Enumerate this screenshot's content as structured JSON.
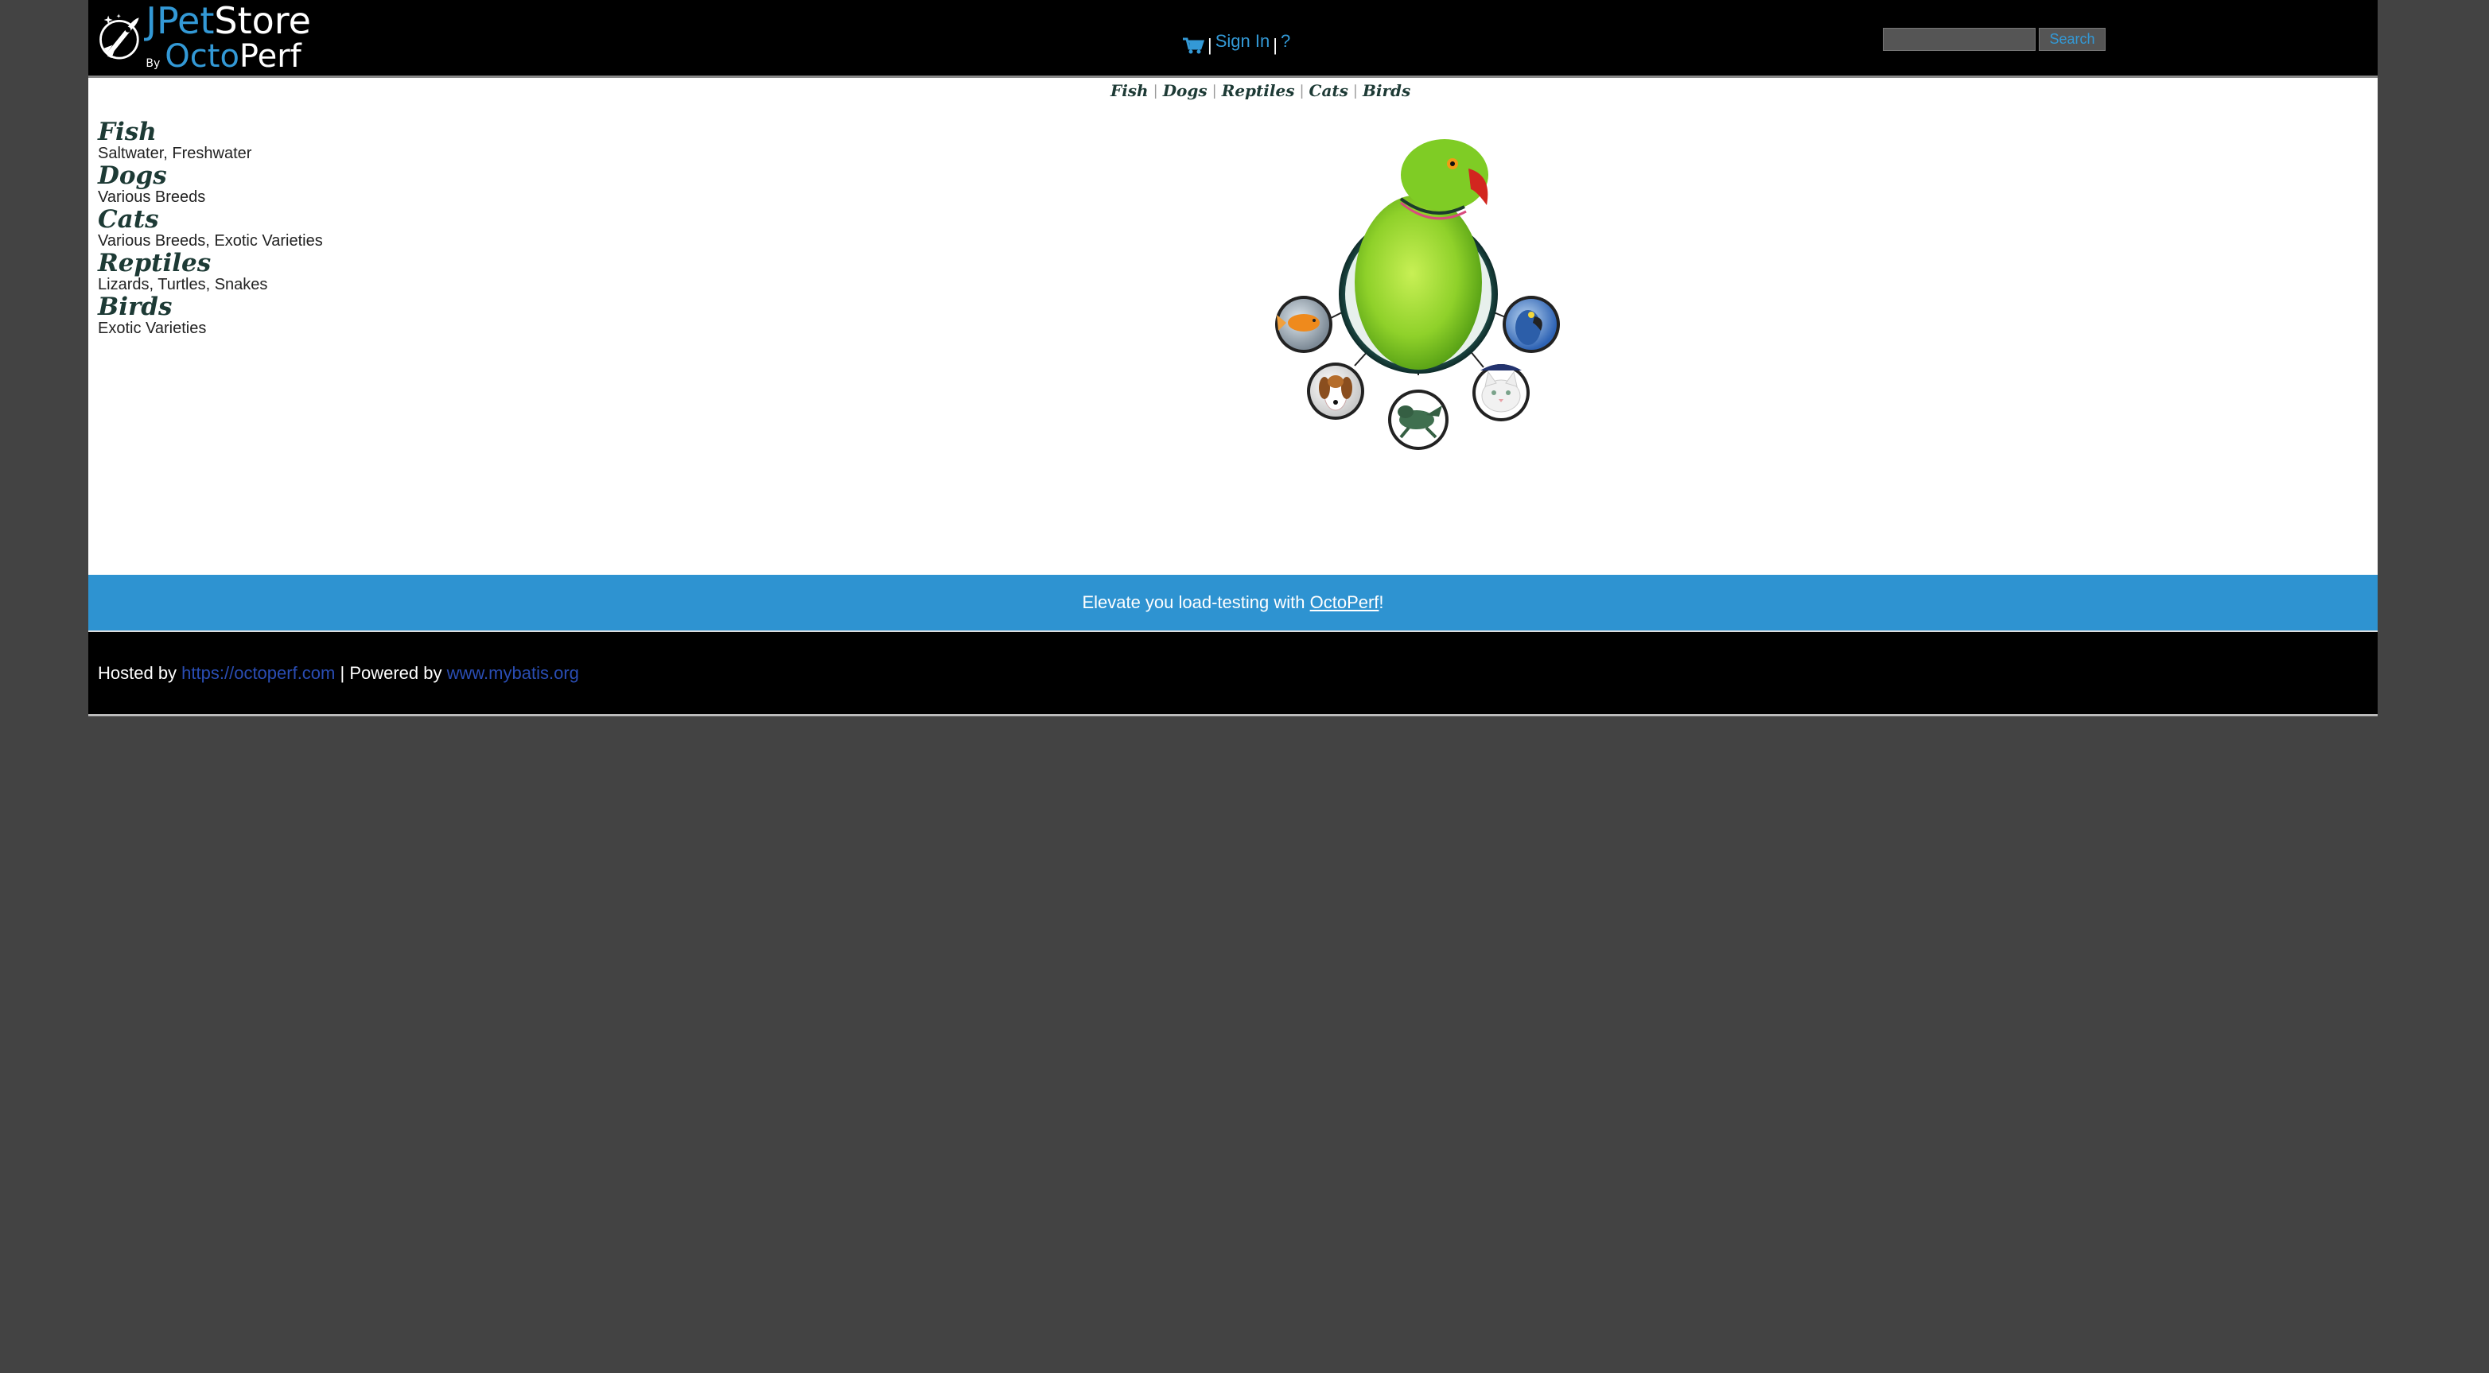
{
  "header": {
    "logo_jpet": "JPet",
    "logo_store": "Store",
    "logo_by": "By",
    "logo_octo": "Octo",
    "logo_perf": "Perf",
    "cart_icon": "shopping-cart-icon",
    "menu_separator": "|",
    "sign_in": "Sign In",
    "help": "?",
    "search_placeholder": "",
    "search_button": "Search"
  },
  "quick_links": [
    "Fish",
    "Dogs",
    "Reptiles",
    "Cats",
    "Birds"
  ],
  "quick_link_separator": "|",
  "sidebar": {
    "categories": [
      {
        "name": "Fish",
        "description": "Saltwater, Freshwater"
      },
      {
        "name": "Dogs",
        "description": "Various Breeds"
      },
      {
        "name": "Cats",
        "description": "Various Breeds, Exotic Varieties"
      },
      {
        "name": "Reptiles",
        "description": "Lizards, Turtles, Snakes"
      },
      {
        "name": "Birds",
        "description": "Exotic Varieties"
      }
    ]
  },
  "banner": {
    "text_before": "Elevate you load-testing with ",
    "link_text": "OctoPerf",
    "text_after": "!"
  },
  "footer": {
    "hosted_by": "Hosted by ",
    "hosted_link": "https://octoperf.com",
    "powered_by": " | Powered by ",
    "powered_link": "www.mybatis.org"
  },
  "colors": {
    "background": "#434343",
    "header": "#000000",
    "accent": "#3399d6",
    "banner": "#2e93d1",
    "category_text": "#1d3a35"
  }
}
